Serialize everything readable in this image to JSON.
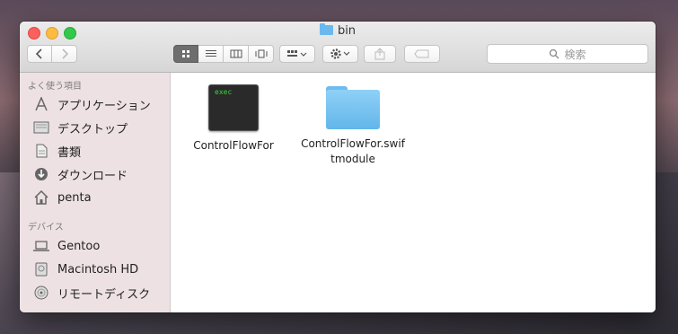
{
  "window": {
    "title": "bin"
  },
  "toolbar": {
    "back_icon": "chevron-left-icon",
    "forward_icon": "chevron-right-icon",
    "view_modes": [
      "icon-view",
      "list-view",
      "column-view",
      "cover-flow-view"
    ],
    "search_placeholder": "検索"
  },
  "sidebar": {
    "favorites_heading": "よく使う項目",
    "favorites": [
      {
        "label": "アプリケーション",
        "icon": "applications-icon"
      },
      {
        "label": "デスクトップ",
        "icon": "desktop-icon"
      },
      {
        "label": "書類",
        "icon": "documents-icon"
      },
      {
        "label": "ダウンロード",
        "icon": "downloads-icon"
      },
      {
        "label": "penta",
        "icon": "home-icon"
      }
    ],
    "devices_heading": "デバイス",
    "devices": [
      {
        "label": "Gentoo",
        "icon": "laptop-icon"
      },
      {
        "label": "Macintosh HD",
        "icon": "hard-drive-icon"
      },
      {
        "label": "リモートディスク",
        "icon": "disc-icon"
      }
    ]
  },
  "files": [
    {
      "name": "ControlFlowFor",
      "type": "executable",
      "icon_text": "exec"
    },
    {
      "name_line1": "ControlFlowFor.swif",
      "name_line2": "tmodule",
      "type": "folder"
    }
  ]
}
